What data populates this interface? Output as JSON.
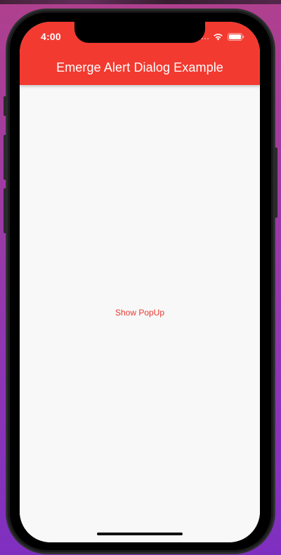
{
  "status_bar": {
    "time": "4:00",
    "signal_icon": "cellular-signal-icon",
    "wifi_icon": "wifi-icon",
    "battery_icon": "battery-icon"
  },
  "app_bar": {
    "title": "Emerge Alert Dialog Example",
    "background_color": "#f33a30"
  },
  "main": {
    "show_popup_label": "Show PopUp",
    "button_color": "#e53a2f"
  }
}
